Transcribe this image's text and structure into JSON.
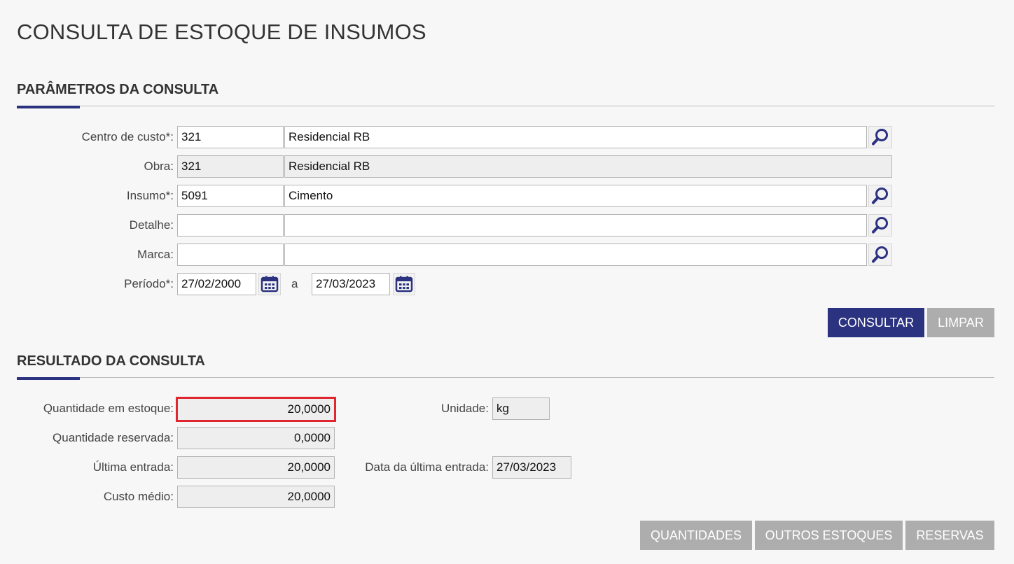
{
  "page": {
    "title": "CONSULTA DE ESTOQUE DE INSUMOS"
  },
  "params": {
    "section_title": "PARÂMETROS DA CONSULTA",
    "centro_custo": {
      "label": "Centro de custo*:",
      "code": "321",
      "name": "Residencial RB"
    },
    "obra": {
      "label": "Obra:",
      "code": "321",
      "name": "Residencial RB"
    },
    "insumo": {
      "label": "Insumo*:",
      "code": "5091",
      "name": "Cimento"
    },
    "detalhe": {
      "label": "Detalhe:",
      "code": "",
      "name": ""
    },
    "marca": {
      "label": "Marca:",
      "code": "",
      "name": ""
    },
    "periodo": {
      "label": "Período*:",
      "start": "27/02/2000",
      "separator": "a",
      "end": "27/03/2023"
    },
    "consultar_label": "CONSULTAR",
    "limpar_label": "LIMPAR"
  },
  "result": {
    "section_title": "RESULTADO DA CONSULTA",
    "quantidade_estoque": {
      "label": "Quantidade em estoque:",
      "value": "20,0000"
    },
    "quantidade_reservada": {
      "label": "Quantidade reservada:",
      "value": "0,0000"
    },
    "ultima_entrada": {
      "label": "Última entrada:",
      "value": "20,0000"
    },
    "custo_medio": {
      "label": "Custo médio:",
      "value": "20,0000"
    },
    "unidade": {
      "label": "Unidade:",
      "value": "kg"
    },
    "data_ultima_entrada": {
      "label": "Data da última entrada:",
      "value": "27/03/2023"
    },
    "quantidades_label": "QUANTIDADES",
    "outros_estoques_label": "OUTROS ESTOQUES",
    "reservas_label": "RESERVAS"
  },
  "colors": {
    "accent": "#2b3280",
    "highlight": "#e0272f",
    "button_gray": "#adadad"
  }
}
